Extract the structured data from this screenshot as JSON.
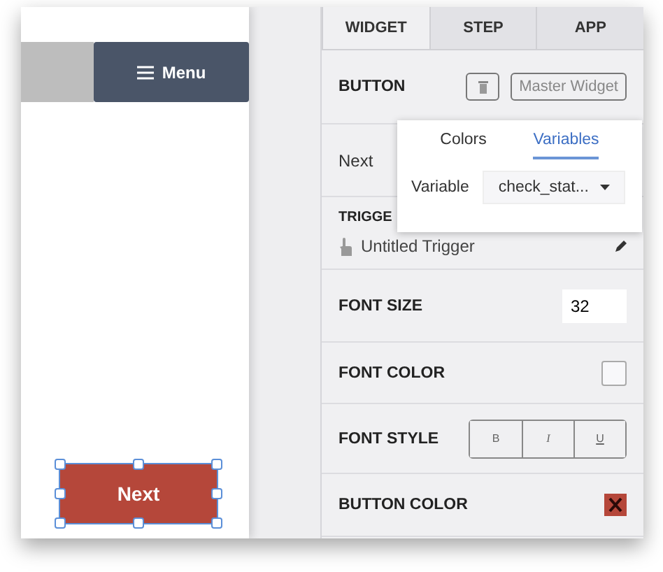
{
  "canvas": {
    "menu_button": {
      "label": "Menu"
    },
    "widget_button": {
      "label": "Next",
      "selected": true
    }
  },
  "panel": {
    "tabs": [
      {
        "label": "WIDGET",
        "selected": true
      },
      {
        "label": "STEP",
        "selected": false
      },
      {
        "label": "APP",
        "selected": false
      }
    ],
    "widget_type": "BUTTON",
    "master_widget_button": "Master Widget",
    "button_text": "Next",
    "popover": {
      "tabs": [
        {
          "label": "Colors",
          "selected": false
        },
        {
          "label": "Variables",
          "selected": true
        }
      ],
      "variable_label": "Variable",
      "variable_value": "check_stat..."
    },
    "trigger": {
      "heading": "TRIGGE",
      "name": "Untitled Trigger"
    },
    "font_size": {
      "label": "FONT SIZE",
      "value": "32"
    },
    "font_color": {
      "label": "FONT COLOR"
    },
    "font_style": {
      "label": "FONT STYLE",
      "buttons": [
        {
          "label": "B",
          "selected": false
        },
        {
          "label": "I",
          "selected": false
        },
        {
          "label": "U",
          "selected": false
        }
      ]
    },
    "button_color": {
      "label": "BUTTON COLOR"
    }
  }
}
